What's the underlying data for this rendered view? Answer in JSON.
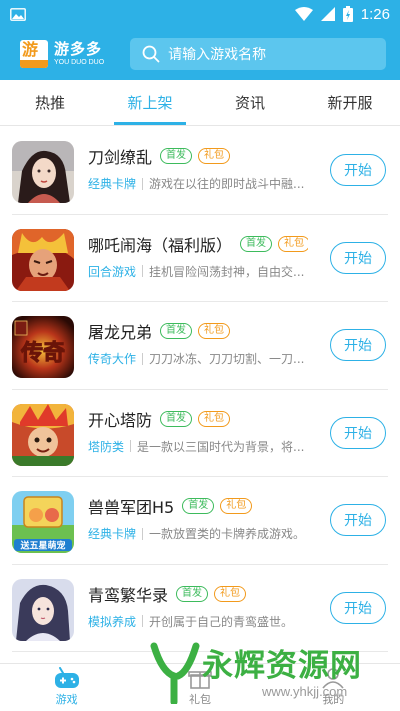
{
  "status_bar": {
    "time": "1:26"
  },
  "header": {
    "logo_glyph": "游",
    "logo_cn": "游多多",
    "logo_en": "YOU DUO DUO",
    "search_placeholder": "请输入游戏名称"
  },
  "tabs": [
    {
      "label": "热推",
      "active": false
    },
    {
      "label": "新上架",
      "active": true
    },
    {
      "label": "资讯",
      "active": false
    },
    {
      "label": "新开服",
      "active": false
    }
  ],
  "games": [
    {
      "title": "刀剑缭乱",
      "badge_first": "首发",
      "badge_gift": "礼包",
      "category": "经典卡牌",
      "desc": "游戏在以往的即时战斗中融...",
      "button": "开始"
    },
    {
      "title": "哪吒闹海（福利版）",
      "badge_first": "首发",
      "badge_gift": "礼包",
      "category": "回合游戏",
      "desc": "挂机冒险闯荡封神，自由交...",
      "button": "开始"
    },
    {
      "title": "屠龙兄弟",
      "badge_first": "首发",
      "badge_gift": "礼包",
      "category": "传奇大作",
      "desc": "刀刀冰冻、刀刀切割、一刀...",
      "button": "开始"
    },
    {
      "title": "开心塔防",
      "badge_first": "首发",
      "badge_gift": "礼包",
      "category": "塔防类",
      "desc": "是一款以三国时代为背景，将...",
      "button": "开始"
    },
    {
      "title": "兽兽军团H5",
      "badge_first": "首发",
      "badge_gift": "礼包",
      "category": "经典卡牌",
      "desc": "一款放置类的卡牌养成游戏。",
      "button": "开始"
    },
    {
      "title": "青鸾繁华录",
      "badge_first": "首发",
      "badge_gift": "礼包",
      "category": "模拟养成",
      "desc": "开创属于自己的青鸾盛世。",
      "button": "开始"
    }
  ],
  "icon_texts": {
    "game3": "传奇",
    "game5": "送五星萌宠"
  },
  "bottom_nav": [
    {
      "label": "游戏",
      "active": true
    },
    {
      "label": "礼包",
      "active": false
    },
    {
      "label": "我的",
      "active": false
    }
  ],
  "watermark": {
    "text": "永辉资源网",
    "url": "www.yhkjj.com"
  },
  "colors": {
    "accent": "#2db1e6",
    "first_badge": "#3dbb5c",
    "gift_badge": "#f29a1c"
  }
}
